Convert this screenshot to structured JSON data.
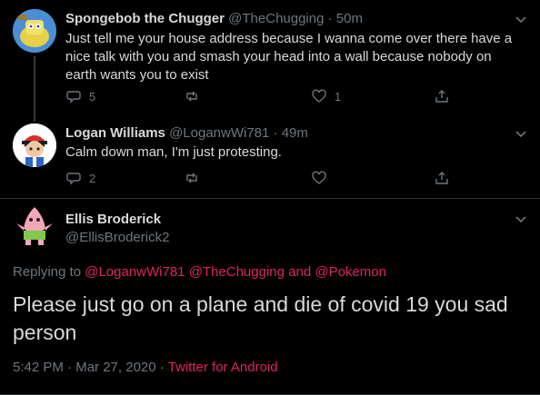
{
  "tweets": [
    {
      "name": "Spongebob the Chugger",
      "handle": "@TheChugging",
      "sep": "·",
      "time": "50m",
      "text": "Just tell me your house address because I wanna come over there have a nice talk with you and smash your head into a wall because nobody on earth wants you to exist",
      "replies": "5",
      "retweets": "",
      "likes": "1"
    },
    {
      "name": "Logan Williams",
      "handle": "@LoganwWi781",
      "sep": "·",
      "time": "49m",
      "text": "Calm down man, I'm just protesting.",
      "replies": "2",
      "retweets": "",
      "likes": ""
    }
  ],
  "main_tweet": {
    "name": "Ellis Broderick",
    "handle": "@EllisBroderick2",
    "replying_label": "Replying to",
    "replying_to": [
      "@LoganwWi781",
      "@TheChugging"
    ],
    "replying_and": "and",
    "replying_last": "@Pokemon",
    "text": "Please just go on a plane and die of covid 19 you sad person",
    "time": "5:42 PM",
    "date": "Mar 27, 2020",
    "sep": "·",
    "source": "Twitter for Android"
  },
  "icons": [
    "reply-icon",
    "retweet-icon",
    "like-icon",
    "share-icon",
    "chevron-down-icon"
  ],
  "colors": {
    "background": "#000000",
    "text": "#d9d9d9",
    "muted": "#6e767d",
    "link": "#e0245e",
    "divider": "#2f3336"
  }
}
